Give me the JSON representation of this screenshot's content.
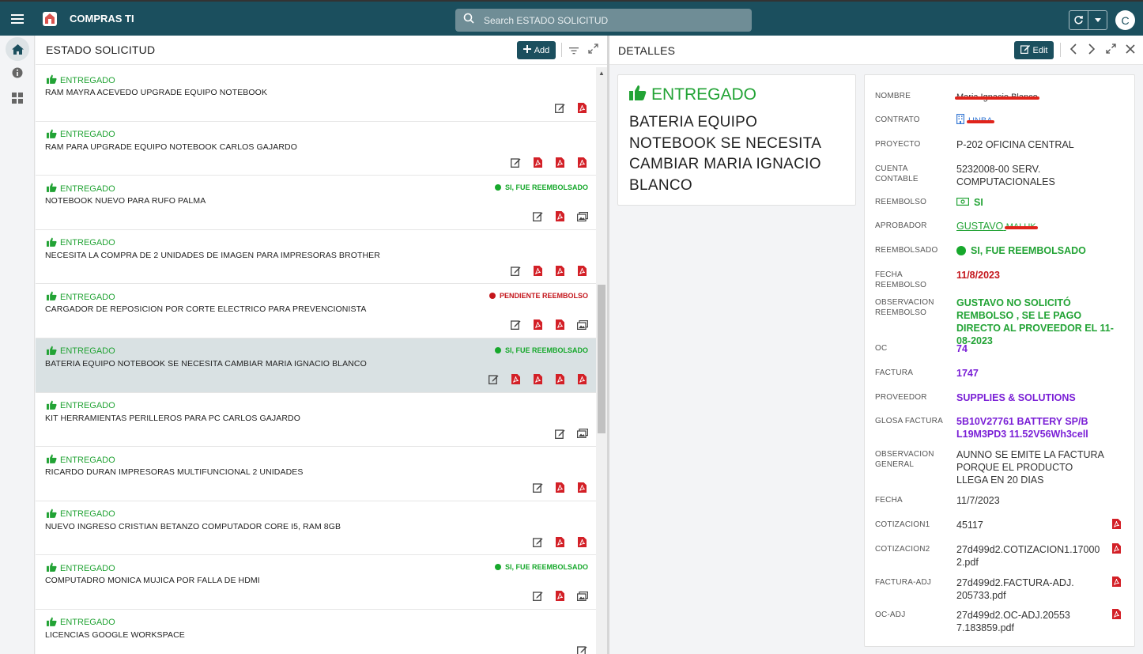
{
  "app": {
    "title": "COMPRAS TI",
    "avatar_letter": "C"
  },
  "search": {
    "placeholder": "Search ESTADO SOLICITUD"
  },
  "list_panel": {
    "title": "ESTADO SOLICITUD",
    "add_label": "Add"
  },
  "rows": [
    {
      "status": "ENTREGADO",
      "title": "RAM MAYRA ACEVEDO UPGRADE EQUIPO NOTEBOOK",
      "badge": "",
      "badge_color": "",
      "actions": [
        "edit",
        "pdf"
      ]
    },
    {
      "status": "ENTREGADO",
      "title": "RAM PARA UPGRADE EQUIPO NOTEBOOK CARLOS GAJARDO",
      "badge": "",
      "badge_color": "",
      "actions": [
        "edit",
        "pdf",
        "pdf",
        "pdf"
      ]
    },
    {
      "status": "ENTREGADO",
      "title": "NOTEBOOK NUEVO PARA RUFO PALMA",
      "badge": "SI, FUE REEMBOLSADO",
      "badge_color": "#17a82c",
      "actions": [
        "edit",
        "pdf",
        "gallery"
      ]
    },
    {
      "status": "ENTREGADO",
      "title": "NECESITA LA COMPRA DE 2 UNIDADES DE IMAGEN PARA IMPRESORAS BROTHER",
      "badge": "",
      "badge_color": "",
      "actions": [
        "edit",
        "pdf",
        "pdf",
        "pdf"
      ]
    },
    {
      "status": "ENTREGADO",
      "title": "CARGADOR DE REPOSICION POR CORTE ELECTRICO PARA PREVENCIONISTA",
      "badge": "PENDIENTE REEMBOLSO",
      "badge_color": "#c4161c",
      "actions": [
        "edit",
        "pdf",
        "pdf",
        "gallery"
      ]
    },
    {
      "status": "ENTREGADO",
      "title": "BATERIA EQUIPO NOTEBOOK SE NECESITA CAMBIAR MARIA IGNACIO BLANCO",
      "badge": "SI, FUE REEMBOLSADO",
      "badge_color": "#17a82c",
      "actions": [
        "edit",
        "pdf",
        "pdf",
        "pdf",
        "pdf"
      ],
      "selected": true
    },
    {
      "status": "ENTREGADO",
      "title": "KIT HERRAMIENTAS PERILLEROS PARA PC CARLOS GAJARDO",
      "badge": "",
      "badge_color": "",
      "actions": [
        "edit",
        "gallery"
      ]
    },
    {
      "status": "ENTREGADO",
      "title": "RICARDO DURAN IMPRESORAS MULTIFUNCIONAL 2 UNIDADES",
      "badge": "",
      "badge_color": "",
      "actions": [
        "edit",
        "pdf",
        "pdf"
      ]
    },
    {
      "status": "ENTREGADO",
      "title": "NUEVO INGRESO CRISTIAN BETANZO COMPUTADOR CORE I5, RAM 8GB",
      "badge": "",
      "badge_color": "",
      "actions": [
        "edit",
        "pdf",
        "pdf"
      ]
    },
    {
      "status": "ENTREGADO",
      "title": "COMPUTADRO MONICA MUJICA POR FALLA DE HDMI",
      "badge": "SI, FUE REEMBOLSADO",
      "badge_color": "#17a82c",
      "actions": [
        "edit",
        "pdf",
        "gallery"
      ]
    },
    {
      "status": "ENTREGADO",
      "title": "LICENCIAS GOOGLE WORKSPACE",
      "badge": "",
      "badge_color": "",
      "actions": [
        "edit"
      ]
    }
  ],
  "detail": {
    "header_title": "DETALLES",
    "edit_label": "Edit",
    "status": "ENTREGADO",
    "title": "BATERIA EQUIPO NOTEBOOK SE NECESITA CAMBIAR MARIA IGNACIO BLANCO",
    "fields": {
      "nombre": {
        "label": "NOMBRE",
        "value": "Maria Ignacio Blanco"
      },
      "contrato": {
        "label": "CONTRATO",
        "value": "UNBA"
      },
      "proyecto": {
        "label": "PROYECTO",
        "value": "P-202  OFICINA CENTRAL"
      },
      "cuenta": {
        "label": "CUENTA CONTABLE",
        "value": "5232008-00 SERV. COMPUTACIONALES"
      },
      "reembolso": {
        "label": "REEMBOLSO",
        "value": "SI"
      },
      "aprobador": {
        "label": "APROBADOR",
        "value": "GUSTAVO",
        "value_hidden": "MALUK"
      },
      "reembolsado": {
        "label": "REEMBOLSADO",
        "value": "SI, FUE REEMBOLSADO"
      },
      "fecha_reembolso": {
        "label": "FECHA REEMBOLSO",
        "value": "11/8/2023"
      },
      "obs_reembolso": {
        "label": "OBSERVACION REEMBOLSO",
        "value": "GUSTAVO NO SOLICITÓ REMBOLSO , SE LE PAGO DIRECTO AL PROVEEDOR EL 11-08-2023"
      },
      "oc": {
        "label": "OC",
        "value": "74"
      },
      "factura": {
        "label": "FACTURA",
        "value": "1747"
      },
      "proveedor": {
        "label": "PROVEEDOR",
        "value": "SUPPLIES & SOLUTIONS"
      },
      "glosa": {
        "label": "GLOSA FACTURA",
        "value": "5B10V27761 BATTERY SP/B L19M3PD3 11.52V56Wh3cell"
      },
      "obs_general": {
        "label": "OBSERVACION GENERAL",
        "value": "AUNNO SE EMITE LA FACTURA PORQUE EL PRODUCTO LLEGA EN 20 DIAS"
      },
      "fecha": {
        "label": "FECHA",
        "value": "11/7/2023"
      },
      "cot1": {
        "label": "COTIZACION1",
        "value": "45117"
      },
      "cot2": {
        "label": "COTIZACION2",
        "value": "27d499d2.COTIZACION1.170002.pdf"
      },
      "factura_adj": {
        "label": "FACTURA-ADJ",
        "value": "27d499d2.FACTURA-ADJ.205733.pdf"
      },
      "oc_adj": {
        "label": "OC-ADJ",
        "value": "27d499d2.OC-ADJ.205537.183859.pdf"
      }
    }
  },
  "colors": {
    "brand": "#1b4f5e",
    "green": "#22a335",
    "purple": "#7a1fd6",
    "red": "#c4161c"
  },
  "icons": [
    "menu-icon",
    "logo-icon",
    "search-icon",
    "sync-icon",
    "caret-down-icon",
    "home-icon",
    "info-icon",
    "grid-icon",
    "plus-icon",
    "filter-icon",
    "expand-icon",
    "thumbs-up-icon",
    "edit-icon",
    "pdf-icon",
    "gallery-icon",
    "chevron-left-icon",
    "chevron-right-icon",
    "close-icon",
    "money-icon",
    "building-icon"
  ]
}
